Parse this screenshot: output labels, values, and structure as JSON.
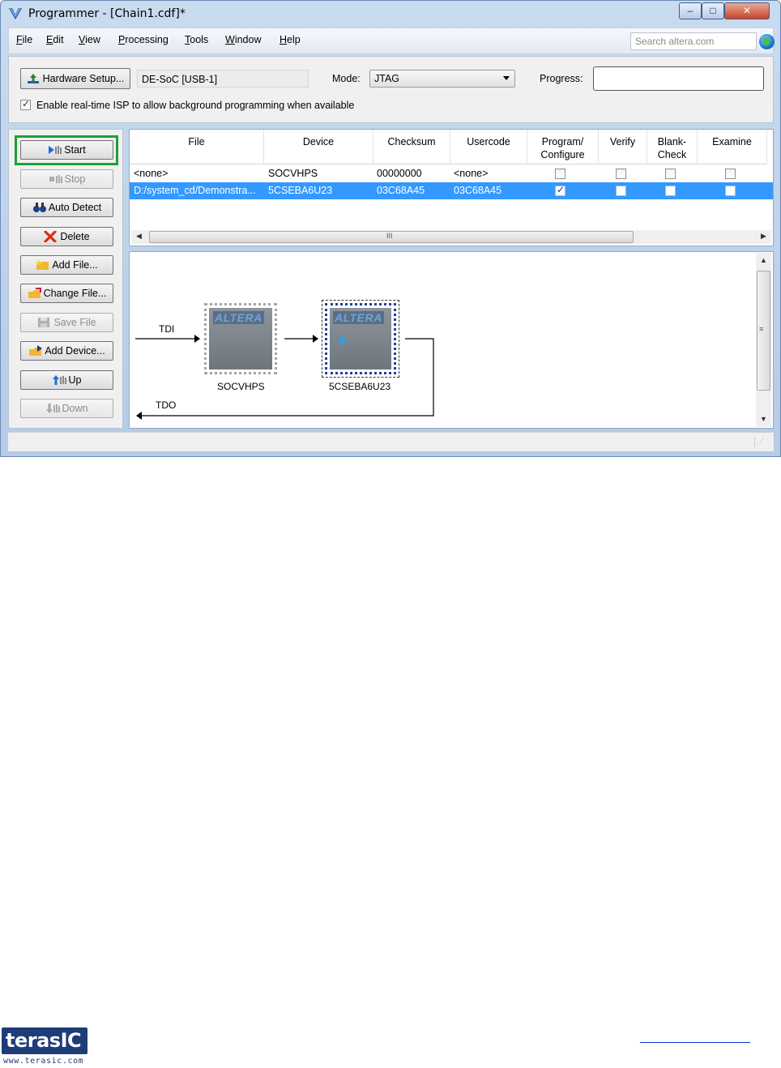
{
  "window": {
    "title": "Programmer - [Chain1.cdf]*",
    "controls": {
      "minimize": "‒",
      "maximize": "□",
      "close": "✕"
    }
  },
  "menu": {
    "items": [
      {
        "label": "File",
        "accel": "F",
        "rest": "ile"
      },
      {
        "label": "Edit",
        "accel": "E",
        "rest": "dit"
      },
      {
        "label": "View",
        "accel": "V",
        "rest": "iew"
      },
      {
        "label": "Processing",
        "accel": "P",
        "rest": "rocessing"
      },
      {
        "label": "Tools",
        "accel": "T",
        "rest": "ools"
      },
      {
        "label": "Window",
        "accel": "W",
        "rest": "indow"
      },
      {
        "label": "Help",
        "accel": "H",
        "rest": "elp"
      }
    ],
    "search_placeholder": "Search altera.com"
  },
  "hardware": {
    "setup_label": "Hardware Setup...",
    "device": "DE-SoC [USB-1]",
    "mode_label": "Mode:",
    "mode_value": "JTAG",
    "progress_label": "Progress:",
    "progress_value": 0,
    "isp_checked": true,
    "isp_label": "Enable real-time ISP to allow background programming when available"
  },
  "toolbar": {
    "start": "Start",
    "stop": "Stop",
    "auto_detect": "Auto Detect",
    "delete": "Delete",
    "add_file": "Add File...",
    "change_file": "Change File...",
    "save_file": "Save File",
    "add_device": "Add Device...",
    "up": "Up",
    "down": "Down"
  },
  "table": {
    "headers": [
      "File",
      "Device",
      "Checksum",
      "Usercode",
      "Program/\nConfigure",
      "Verify",
      "Blank-\nCheck",
      "Examine"
    ],
    "rows": [
      {
        "file": "<none>",
        "device": "SOCVHPS",
        "checksum": "00000000",
        "usercode": "<none>",
        "program": false,
        "verify": false,
        "blank": false,
        "examine": false,
        "selected": false
      },
      {
        "file": "D:/system_cd/Demonstra...",
        "device": "5CSEBA6U23",
        "checksum": "03C68A45",
        "usercode": "03C68A45",
        "program": true,
        "verify": false,
        "blank": false,
        "examine": false,
        "selected": true
      }
    ],
    "scroll_grip": "III"
  },
  "diagram": {
    "tdi_label": "TDI",
    "tdo_label": "TDO",
    "chip_brand": "ALTERA",
    "chips": [
      "SOCVHPS",
      "5CSEBA6U23"
    ]
  },
  "colors": {
    "selection": "#3399ff",
    "start_highlight": "#1ea03a",
    "window_frame": "#b5cbe6"
  },
  "footer": {
    "logo_top": "terasIC",
    "logo_bottom": "www.terasic.com"
  }
}
